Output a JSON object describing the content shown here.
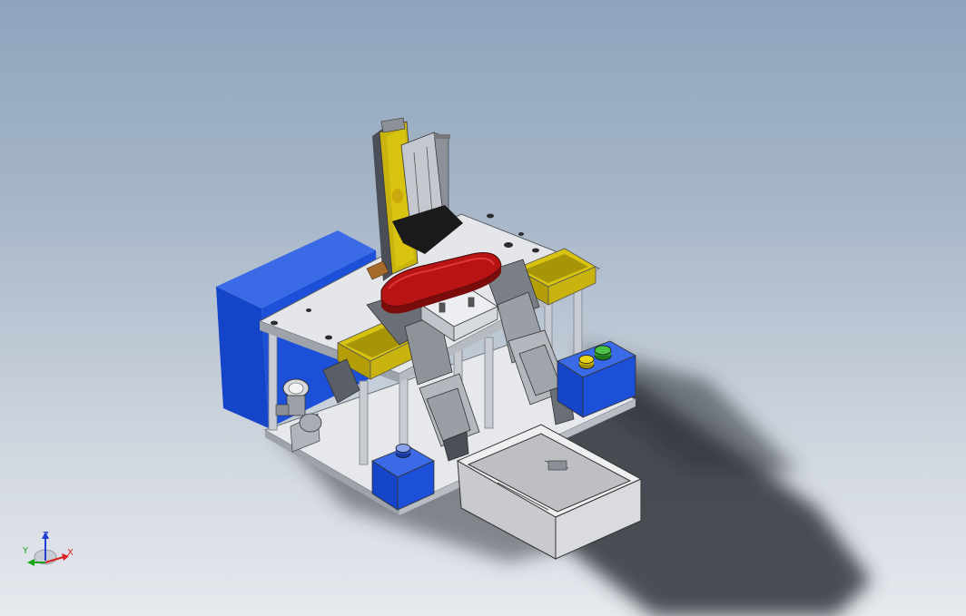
{
  "triad": {
    "x_label": "X",
    "y_label": "Y",
    "z_label": "Z",
    "x_color": "#d92020",
    "y_color": "#18a418",
    "z_color": "#2040d8"
  },
  "colors": {
    "housing_blue": "#1c50d8",
    "frame_yellow": "#c9b30e",
    "fixture_red": "#a81010",
    "tray_grey": "#d6d6d6",
    "plate_white": "#e4e6ea"
  }
}
